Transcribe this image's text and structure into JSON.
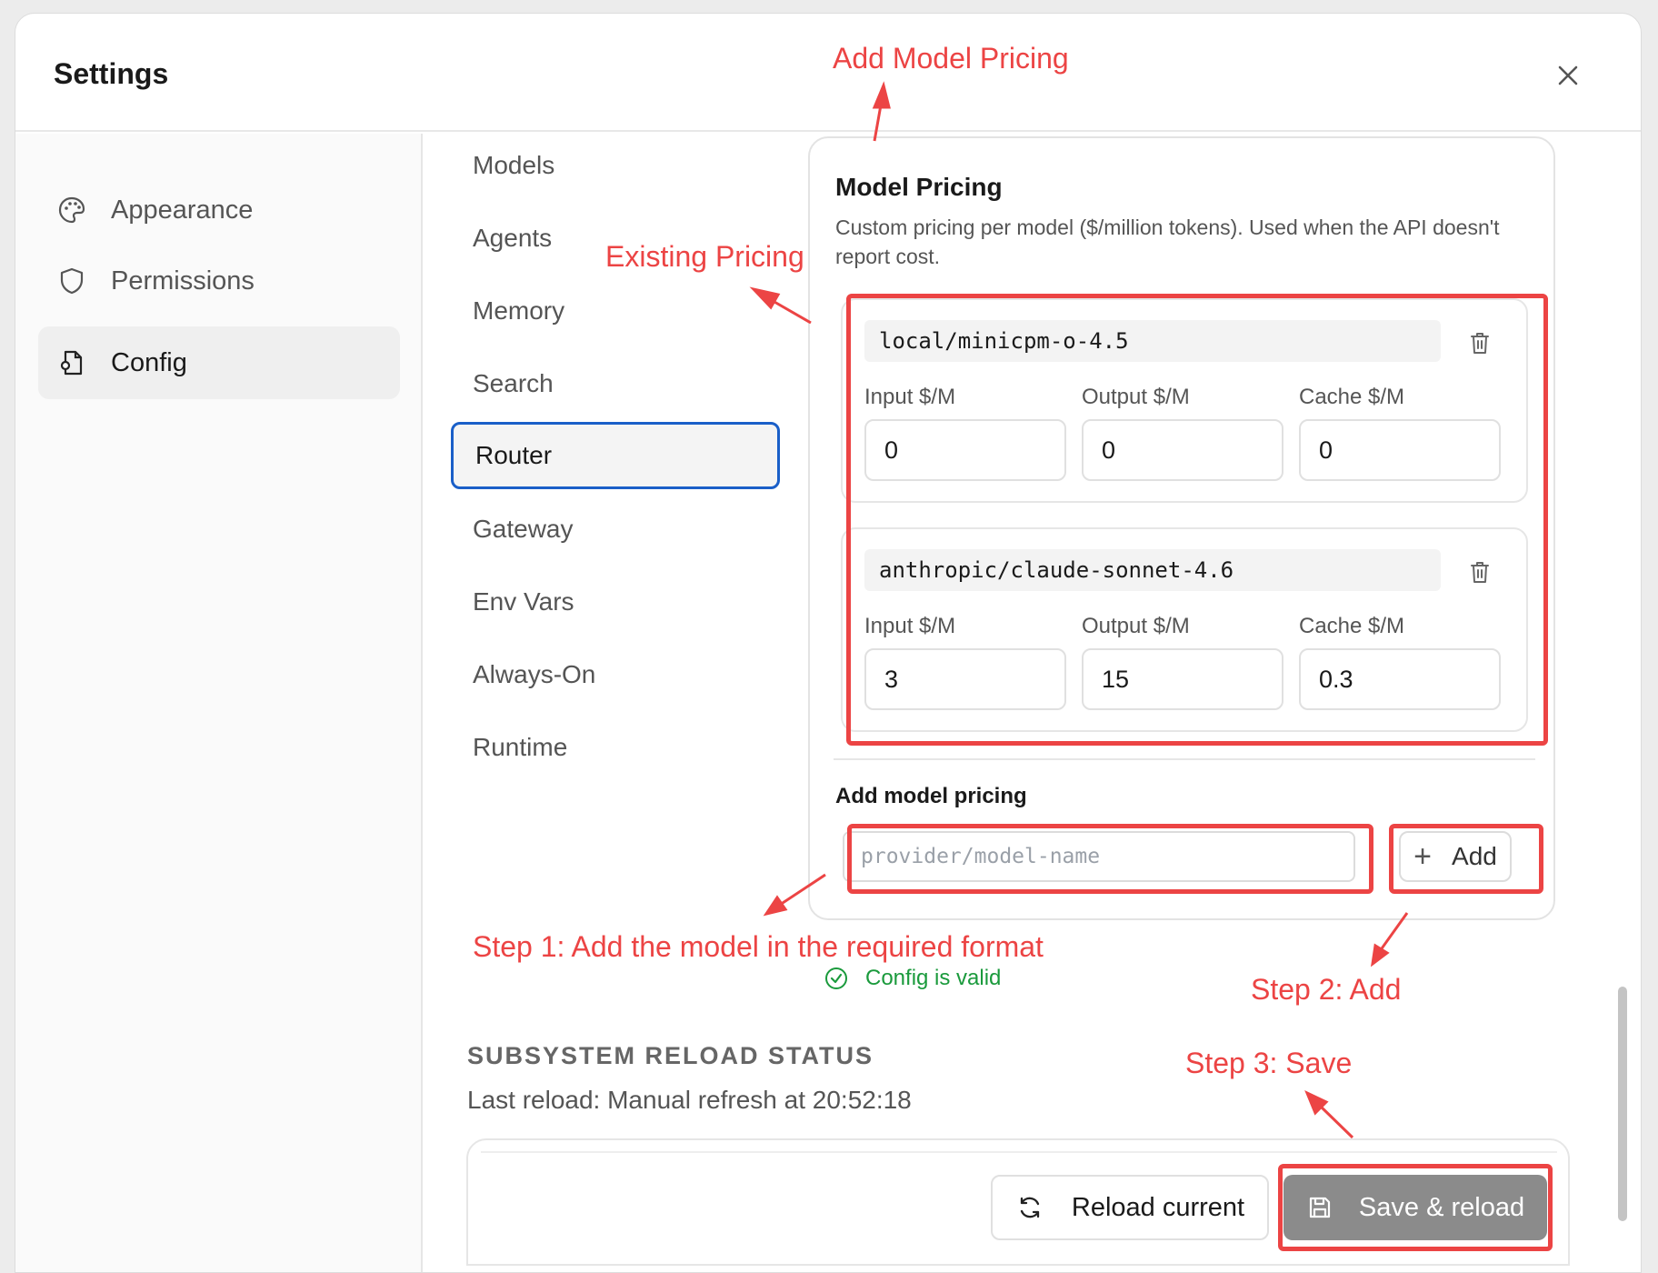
{
  "dialog": {
    "title": "Settings",
    "close_icon": "close-icon"
  },
  "sidebar": {
    "items": [
      {
        "label": "Appearance",
        "icon": "palette-icon",
        "active": false
      },
      {
        "label": "Permissions",
        "icon": "shield-icon",
        "active": false
      },
      {
        "label": "Config",
        "icon": "config-file-icon",
        "active": true
      }
    ]
  },
  "subnav": {
    "items": [
      {
        "label": "Models",
        "active": false
      },
      {
        "label": "Agents",
        "active": false
      },
      {
        "label": "Memory",
        "active": false
      },
      {
        "label": "Search",
        "active": false
      },
      {
        "label": "Router",
        "active": true
      },
      {
        "label": "Gateway",
        "active": false
      },
      {
        "label": "Env Vars",
        "active": false
      },
      {
        "label": "Always-On",
        "active": false
      },
      {
        "label": "Runtime",
        "active": false
      }
    ]
  },
  "pricing": {
    "title": "Model Pricing",
    "description": "Custom pricing per model ($/million tokens). Used when the API doesn't report cost.",
    "models": [
      {
        "name": "local/minicpm-o-4.5",
        "input_label": "Input $/M",
        "output_label": "Output $/M",
        "cache_label": "Cache $/M",
        "input": "0",
        "output": "0",
        "cache": "0"
      },
      {
        "name": "anthropic/claude-sonnet-4.6",
        "input_label": "Input $/M",
        "output_label": "Output $/M",
        "cache_label": "Cache $/M",
        "input": "3",
        "output": "15",
        "cache": "0.3"
      }
    ],
    "add_title": "Add model pricing",
    "add_placeholder": "provider/model-name",
    "add_button": "Add"
  },
  "validation": {
    "text": "Config is valid",
    "color": "#1a9a3c"
  },
  "reload_status": {
    "title": "SUBSYSTEM RELOAD STATUS",
    "last_reload": "Last reload: Manual refresh at 20:52:18"
  },
  "footer": {
    "reload_button": "Reload current",
    "save_button": "Save & reload"
  },
  "annotations": {
    "color": "#ec4444",
    "add_model_pricing": "Add Model Pricing",
    "existing_pricing": "Existing Pricing",
    "step1": "Step 1: Add the model in the required format",
    "step2": "Step 2: Add",
    "step3": "Step 3: Save"
  }
}
